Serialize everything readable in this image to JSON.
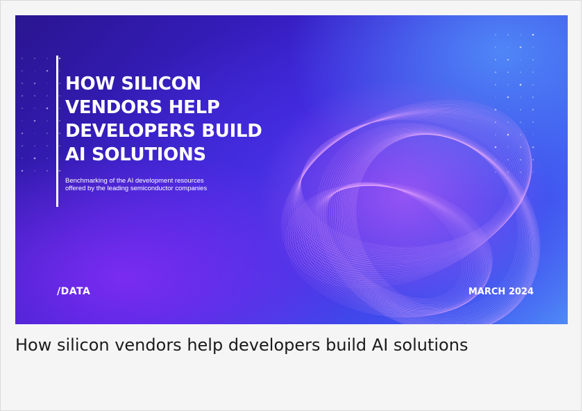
{
  "cover": {
    "headline": "HOW SILICON\nVENDORS HELP\nDEVELOPERS BUILD\nAI SOLUTIONS",
    "subtitle": "Benchmarking of the AI development resources\noffered by the leading semiconductor companies",
    "brand_logo": "/DATA",
    "date": "MARCH 2024"
  },
  "caption": "How silicon vendors help developers build AI solutions"
}
